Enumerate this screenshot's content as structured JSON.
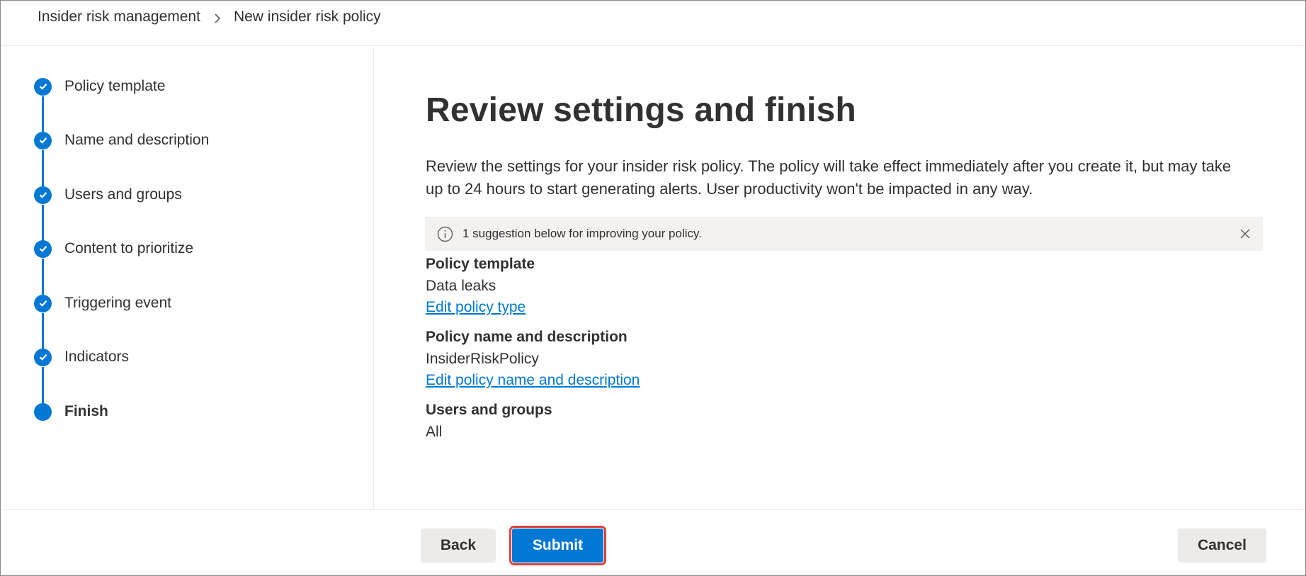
{
  "breadcrumb": {
    "root": "Insider risk management",
    "current": "New insider risk policy"
  },
  "wizard": {
    "steps": [
      {
        "label": "Policy template",
        "state": "completed"
      },
      {
        "label": "Name and description",
        "state": "completed"
      },
      {
        "label": "Users and groups",
        "state": "completed"
      },
      {
        "label": "Content to prioritize",
        "state": "completed"
      },
      {
        "label": "Triggering event",
        "state": "completed"
      },
      {
        "label": "Indicators",
        "state": "completed"
      },
      {
        "label": "Finish",
        "state": "current"
      }
    ]
  },
  "main": {
    "title": "Review settings and finish",
    "intro": "Review the settings for your insider risk policy. The policy will take effect immediately after you create it, but may take up to 24 hours to start generating alerts. User productivity won't be impacted in any way.",
    "notice": {
      "icon": "info-icon",
      "text": "1 suggestion below for improving your policy."
    },
    "sections": {
      "template": {
        "label": "Policy template",
        "value": "Data leaks",
        "link": "Edit policy type"
      },
      "name": {
        "label": "Policy name and description",
        "value": "InsiderRiskPolicy",
        "link": "Edit policy name and description"
      },
      "users": {
        "label": "Users and groups",
        "value": "All"
      }
    }
  },
  "footer": {
    "back_label": "Back",
    "submit_label": "Submit",
    "cancel_label": "Cancel"
  },
  "colors": {
    "accent": "#0078d4",
    "highlight": "#e0403c",
    "notice_bg": "#f3f2f1",
    "button_bg": "#edebe9"
  }
}
